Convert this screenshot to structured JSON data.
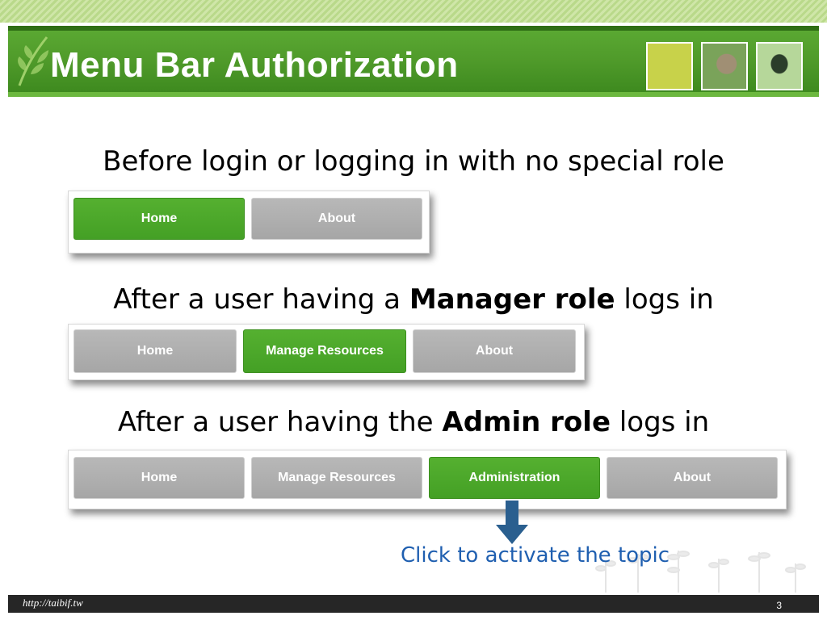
{
  "slide": {
    "title": "Menu Bar Authorization",
    "page_number": "3",
    "footer_url": "http://taibif.tw"
  },
  "sections": [
    {
      "caption_parts": [
        "Before login or logging in with no special role"
      ],
      "menu": [
        {
          "label": "Home",
          "active": true
        },
        {
          "label": "About",
          "active": false
        }
      ]
    },
    {
      "caption_parts": [
        "After a user having a ",
        "Manager role",
        " logs in"
      ],
      "menu": [
        {
          "label": "Home",
          "active": false
        },
        {
          "label": "Manage Resources",
          "active": true
        },
        {
          "label": "About",
          "active": false
        }
      ]
    },
    {
      "caption_parts": [
        "After a user having the ",
        "Admin role",
        " logs in"
      ],
      "menu": [
        {
          "label": "Home",
          "active": false
        },
        {
          "label": "Manage Resources",
          "active": false
        },
        {
          "label": "Administration",
          "active": true
        },
        {
          "label": "About",
          "active": false
        }
      ]
    }
  ],
  "callout": {
    "text": "Click to activate the topic",
    "color": "#1f5fb0",
    "arrow_icon": "down-arrow-icon"
  },
  "colors": {
    "title_bar": "#4f9a2a",
    "menu_active": "#4aa52a",
    "menu_inactive": "#adadad",
    "footer": "#262626"
  }
}
